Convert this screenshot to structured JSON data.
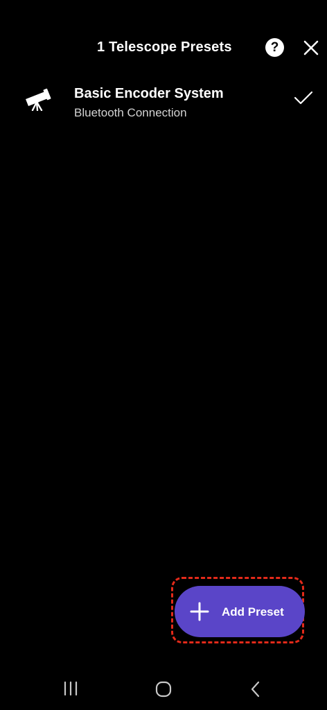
{
  "header": {
    "title": "1 Telescope Presets",
    "help_icon": "help-icon",
    "help_glyph": "?",
    "close_icon": "close-icon"
  },
  "presets": [
    {
      "name": "Basic Encoder System",
      "subtitle": "Bluetooth Connection",
      "icon": "telescope-icon",
      "selected": true
    }
  ],
  "fab": {
    "label": "Add Preset",
    "icon": "plus-icon",
    "color": "#5a45c8"
  },
  "highlight_color": "#e32a1a",
  "navbar": {
    "recents_icon": "recents-icon",
    "home_icon": "home-icon",
    "back_icon": "back-icon"
  }
}
